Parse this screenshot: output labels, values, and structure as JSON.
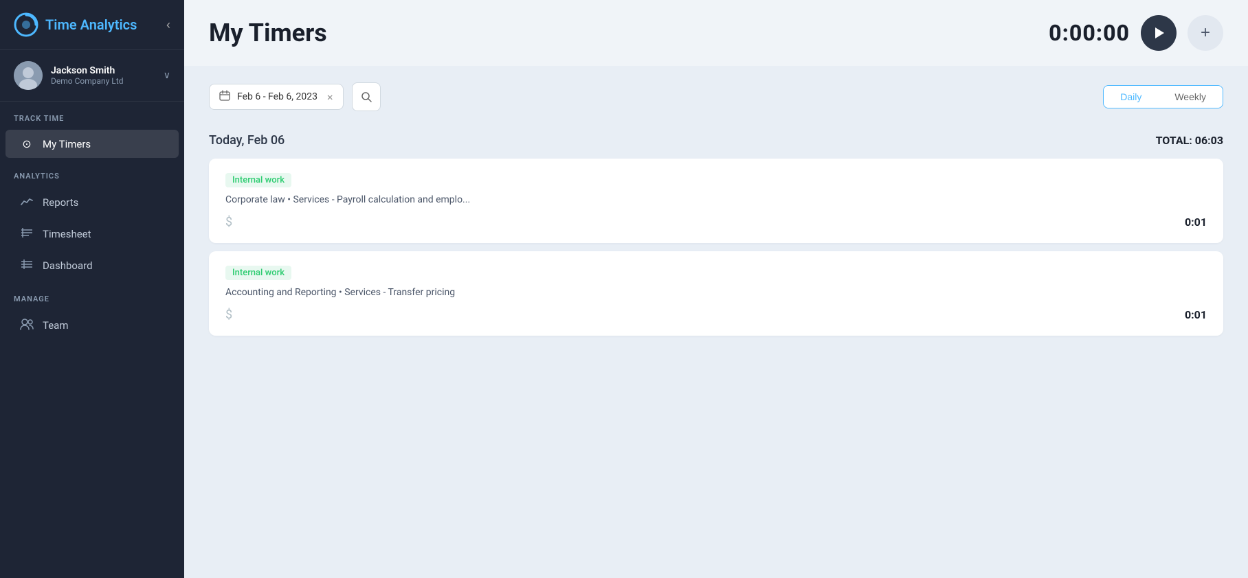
{
  "app": {
    "title": "Time Analytics"
  },
  "sidebar": {
    "collapse_label": "‹",
    "user": {
      "name": "Jackson Smith",
      "company": "Demo Company Ltd",
      "chevron": "∨"
    },
    "sections": [
      {
        "label": "TRACK TIME",
        "items": [
          {
            "id": "my-timers",
            "icon": "⊙",
            "label": "My Timers",
            "active": true
          }
        ]
      },
      {
        "label": "ANALYTICS",
        "items": [
          {
            "id": "reports",
            "icon": "⌇",
            "label": "Reports",
            "active": false
          },
          {
            "id": "timesheet",
            "icon": "≡",
            "label": "Timesheet",
            "active": false
          },
          {
            "id": "dashboard",
            "icon": "≣",
            "label": "Dashboard",
            "active": false
          }
        ]
      },
      {
        "label": "MANAGE",
        "items": [
          {
            "id": "team",
            "icon": "👥",
            "label": "Team",
            "active": false
          }
        ]
      }
    ]
  },
  "header": {
    "page_title": "My Timers",
    "timer_display": "0:00:00",
    "play_icon": "▶",
    "add_icon": "+"
  },
  "toolbar": {
    "date_range": "Feb 6 - Feb 6, 2023",
    "clear_icon": "×",
    "search_icon": "🔍",
    "view_daily": "Daily",
    "view_weekly": "Weekly"
  },
  "content": {
    "day_label": "Today, Feb 06",
    "day_total_label": "TOTAL: 06:03",
    "entries": [
      {
        "tag": "Internal work",
        "description": "Corporate law • Services - Payroll calculation and emplo...",
        "time": "0:01"
      },
      {
        "tag": "Internal work",
        "description": "Accounting and Reporting • Services - Transfer pricing",
        "time": "0:01"
      }
    ]
  }
}
